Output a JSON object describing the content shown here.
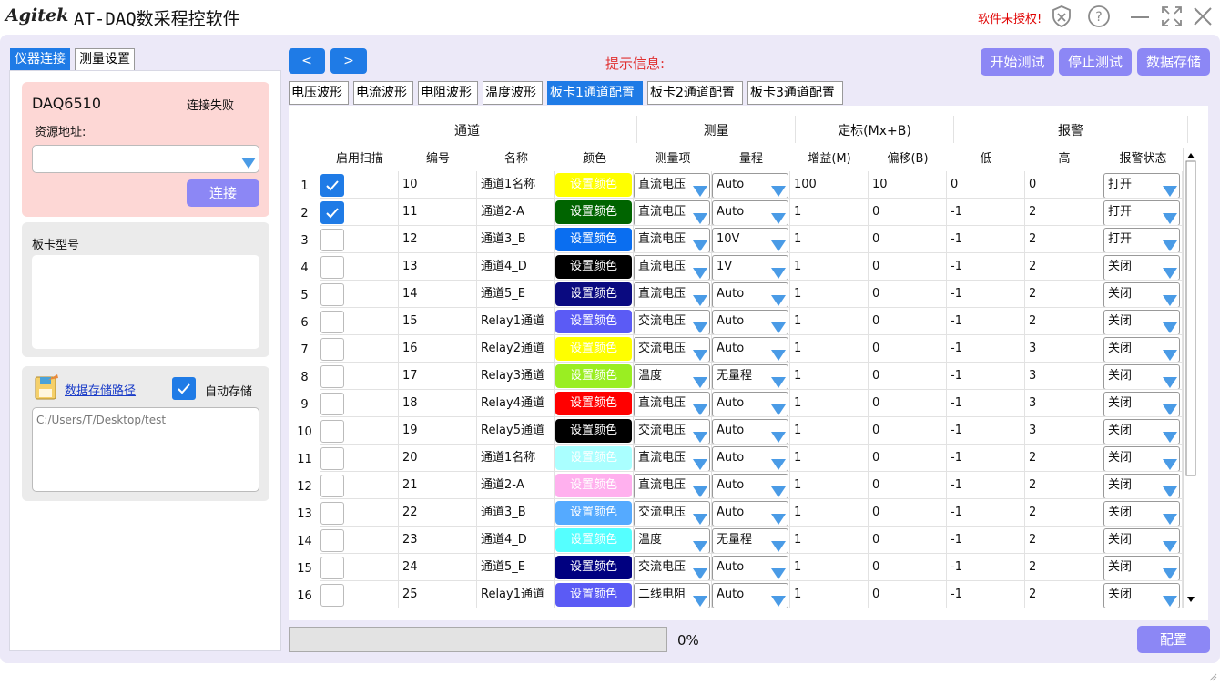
{
  "app": {
    "brand": "Agitek",
    "title": "AT-DAQ数采程控软件",
    "unauthorized": "软件未授权!"
  },
  "left_tabs": [
    "仪器连接",
    "测量设置"
  ],
  "instrument": {
    "model": "DAQ6510",
    "status": "连接失败",
    "resource_label": "资源地址:",
    "resource_value": "",
    "connect_label": "连接"
  },
  "board": {
    "label": "板卡型号"
  },
  "storage": {
    "path_link": "数据存储路径",
    "auto_save_label": "自动存储",
    "auto_save_checked": true,
    "path_value": "C:/Users/T/Desktop/test"
  },
  "nav": {
    "prev": "<",
    "next": ">"
  },
  "hint_label": "提示信息:",
  "actions": {
    "start": "开始测试",
    "stop": "停止测试",
    "save": "数据存储"
  },
  "tabs": [
    "电压波形",
    "电流波形",
    "电阻波形",
    "温度波形",
    "板卡1通道配置",
    "板卡2通道配置",
    "板卡3通道配置"
  ],
  "active_tab": "板卡1通道配置",
  "group_headers": {
    "channel": "通道",
    "measure": "测量",
    "calib": "定标(Mx+B)",
    "alarm": "报警"
  },
  "columns": {
    "scan": "启用扫描",
    "id": "编号",
    "name": "名称",
    "color": "颜色",
    "mtype": "测量项",
    "range": "量程",
    "gain": "增益(M)",
    "offset": "偏移(B)",
    "low": "低",
    "high": "高",
    "alarm": "报警状态"
  },
  "set_color_label": "设置颜色",
  "rows": [
    {
      "n": "1",
      "scan": true,
      "id": "10",
      "name": "通道1名称",
      "color": "#ffff00",
      "mtype": "直流电压",
      "range": "Auto",
      "gain": "100",
      "offset": "10",
      "low": "0",
      "high": "0",
      "alarm": "打开"
    },
    {
      "n": "2",
      "scan": true,
      "id": "11",
      "name": "通道2-A",
      "color": "#006400",
      "mtype": "直流电压",
      "range": "Auto",
      "gain": "1",
      "offset": "0",
      "low": "-1",
      "high": "2",
      "alarm": "打开"
    },
    {
      "n": "3",
      "scan": false,
      "id": "12",
      "name": "通道3_B",
      "color": "#0a6ef0",
      "mtype": "直流电压",
      "range": "10V",
      "gain": "1",
      "offset": "0",
      "low": "-1",
      "high": "2",
      "alarm": "打开"
    },
    {
      "n": "4",
      "scan": false,
      "id": "13",
      "name": "通道4_D",
      "color": "#000000",
      "mtype": "直流电压",
      "range": "1V",
      "gain": "1",
      "offset": "0",
      "low": "-1",
      "high": "2",
      "alarm": "关闭"
    },
    {
      "n": "5",
      "scan": false,
      "id": "14",
      "name": "通道5_E",
      "color": "#0a0a80",
      "mtype": "直流电压",
      "range": "Auto",
      "gain": "1",
      "offset": "0",
      "low": "-1",
      "high": "2",
      "alarm": "关闭"
    },
    {
      "n": "6",
      "scan": false,
      "id": "15",
      "name": "Relay1通道",
      "color": "#5b5bf5",
      "mtype": "交流电压",
      "range": "Auto",
      "gain": "1",
      "offset": "0",
      "low": "-1",
      "high": "2",
      "alarm": "关闭"
    },
    {
      "n": "7",
      "scan": false,
      "id": "16",
      "name": "Relay2通道",
      "color": "#ffff00",
      "mtype": "交流电压",
      "range": "Auto",
      "gain": "1",
      "offset": "0",
      "low": "-1",
      "high": "3",
      "alarm": "关闭"
    },
    {
      "n": "8",
      "scan": false,
      "id": "17",
      "name": "Relay3通道",
      "color": "#9aee22",
      "mtype": "温度",
      "range": "无量程",
      "gain": "1",
      "offset": "0",
      "low": "-1",
      "high": "3",
      "alarm": "关闭"
    },
    {
      "n": "9",
      "scan": false,
      "id": "18",
      "name": "Relay4通道",
      "color": "#ff0000",
      "mtype": "直流电压",
      "range": "Auto",
      "gain": "1",
      "offset": "0",
      "low": "-1",
      "high": "3",
      "alarm": "关闭"
    },
    {
      "n": "10",
      "scan": false,
      "id": "19",
      "name": "Relay5通道",
      "color": "#000000",
      "mtype": "交流电压",
      "range": "Auto",
      "gain": "1",
      "offset": "0",
      "low": "-1",
      "high": "3",
      "alarm": "关闭"
    },
    {
      "n": "11",
      "scan": false,
      "id": "20",
      "name": "通道1名称",
      "color": "#aaffff",
      "mtype": "直流电压",
      "range": "Auto",
      "gain": "1",
      "offset": "0",
      "low": "-1",
      "high": "2",
      "alarm": "关闭"
    },
    {
      "n": "12",
      "scan": false,
      "id": "21",
      "name": "通道2-A",
      "color": "#ffb0ee",
      "mtype": "直流电压",
      "range": "Auto",
      "gain": "1",
      "offset": "0",
      "low": "-1",
      "high": "2",
      "alarm": "关闭"
    },
    {
      "n": "13",
      "scan": false,
      "id": "22",
      "name": "通道3_B",
      "color": "#55aaff",
      "mtype": "交流电压",
      "range": "Auto",
      "gain": "1",
      "offset": "0",
      "low": "-1",
      "high": "2",
      "alarm": "关闭"
    },
    {
      "n": "14",
      "scan": false,
      "id": "23",
      "name": "通道4_D",
      "color": "#55ffff",
      "mtype": "温度",
      "range": "无量程",
      "gain": "1",
      "offset": "0",
      "low": "-1",
      "high": "2",
      "alarm": "关闭"
    },
    {
      "n": "15",
      "scan": false,
      "id": "24",
      "name": "通道5_E",
      "color": "#000080",
      "mtype": "交流电压",
      "range": "Auto",
      "gain": "1",
      "offset": "0",
      "low": "-1",
      "high": "2",
      "alarm": "关闭"
    },
    {
      "n": "16",
      "scan": false,
      "id": "25",
      "name": "Relay1通道",
      "color": "#5b5bf5",
      "mtype": "二线电阻",
      "range": "Auto",
      "gain": "1",
      "offset": "0",
      "low": "-1",
      "high": "2",
      "alarm": "关闭"
    }
  ],
  "progress": {
    "value": 0,
    "label": "0%"
  },
  "config_label": "配置"
}
